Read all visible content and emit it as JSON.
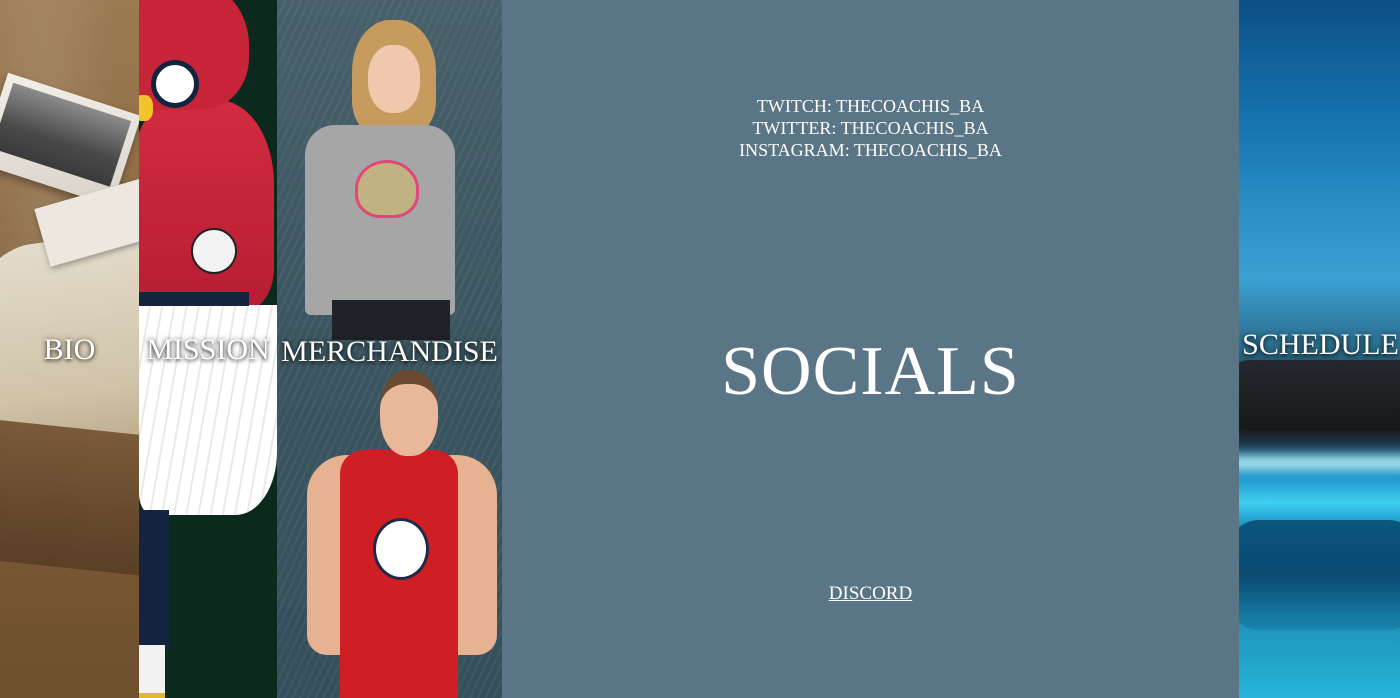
{
  "panels": {
    "bio": {
      "label": "BIO"
    },
    "mission": {
      "label": "MISSION"
    },
    "merchandise": {
      "label": "MERCHANDISE"
    },
    "schedule": {
      "label": "SCHEDULE"
    }
  },
  "socials": {
    "title": "SOCIALS",
    "handles": [
      "TWITCH: THECOACHIS_BA",
      "TWITTER: THECOACHIS_BA",
      "INSTAGRAM: THECOACHIS_BA"
    ],
    "discord_link": "DISCORD"
  },
  "colors": {
    "socials_background": "#5a7585",
    "text": "#ffffff"
  }
}
